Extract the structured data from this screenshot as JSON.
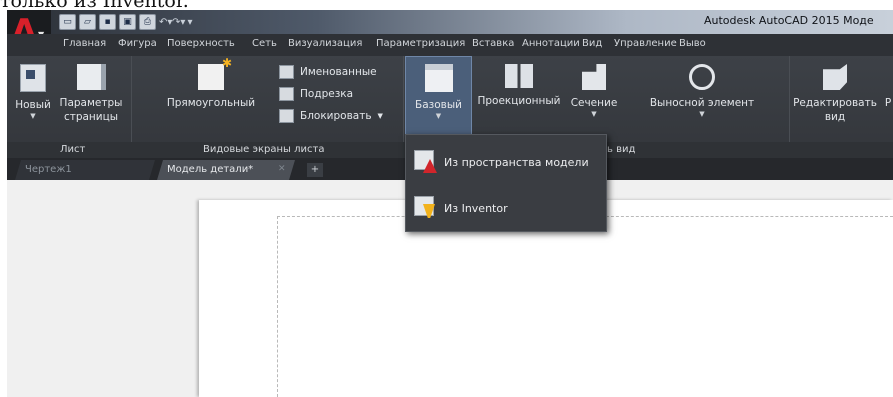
{
  "caption": "только из Inventor.",
  "app_title": "Autodesk AutoCAD 2015   Моде",
  "menu_tabs": [
    "Главная",
    "Фигура",
    "Поверхность",
    "Сеть",
    "Визуализация",
    "Параметризация",
    "Вставка",
    "Аннотации",
    "Вид",
    "Управление",
    "Выво"
  ],
  "ribbon": {
    "new": "Новый",
    "page_params_1": "Параметры",
    "page_params_2": "страницы",
    "rect": "Прямоугольный",
    "named": "Именованные",
    "clip": "Подрезка",
    "lock": "Блокировать",
    "base": "Базовый",
    "projected": "Проекционный",
    "section": "Сечение",
    "detail": "Выносной элемент",
    "edit_1": "Редактировать",
    "edit_2": "вид",
    "edit_partial": "Р"
  },
  "panels": {
    "sheet": "Лист",
    "viewports": "Видовые экраны листа",
    "view_suffix": "ь вид"
  },
  "doc_tabs": {
    "drawing": "Чертеж1",
    "model": "Модель детали*"
  },
  "dropdown": {
    "from_model": "Из пространства модели",
    "from_inventor": "Из Inventor"
  },
  "colors": {
    "autocad_red": "#d8202a",
    "ribbon_bg": "#3d4147",
    "active_blue": "#4b5f7a"
  }
}
